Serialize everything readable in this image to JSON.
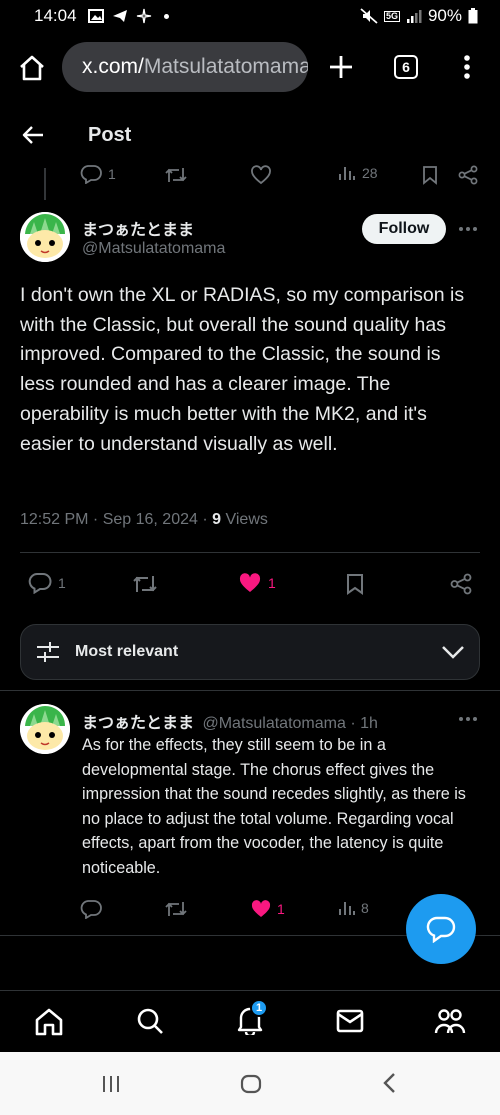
{
  "status_bar": {
    "time": "14:04",
    "network": "5G",
    "battery": "90%"
  },
  "browser": {
    "url_host": "x.com/",
    "url_path": "Matsulatatomama",
    "tab_count": "6"
  },
  "header": {
    "title": "Post"
  },
  "parent_actions": {
    "replies": "1",
    "views": "28"
  },
  "post": {
    "display_name": "まつぁたとまま",
    "handle": "@Matsulatatomama",
    "follow_label": "Follow",
    "text": "I don't own the XL or RADIAS, so my comparison is with the Classic, but overall the sound quality has improved. Compared to the Classic, the sound is less rounded and has a clearer image. The operability is much better with the MK2, and it's easier to understand visually as well.",
    "time": "12:52 PM · Sep 16, 2024 · ",
    "views_count": "9",
    "views_label": " Views",
    "replies": "1",
    "likes": "1"
  },
  "sort": {
    "label": "Most relevant"
  },
  "reply": {
    "display_name": "まつぁたとまま",
    "handle": "@Matsulatatomama",
    "age": " · 1h",
    "text": "As for the effects, they still seem to be in a developmental stage. The chorus effect gives the impression that the sound recedes slightly, as there is no place to adjust the total volume. Regarding vocal effects, apart from the vocoder, the latency is quite noticeable.",
    "likes": "1",
    "views": "8"
  },
  "bottom_nav": {
    "notification_badge": "1"
  },
  "colors": {
    "accent": "#1d9bf0",
    "like_pink": "#f91880",
    "muted": "#71767b"
  }
}
